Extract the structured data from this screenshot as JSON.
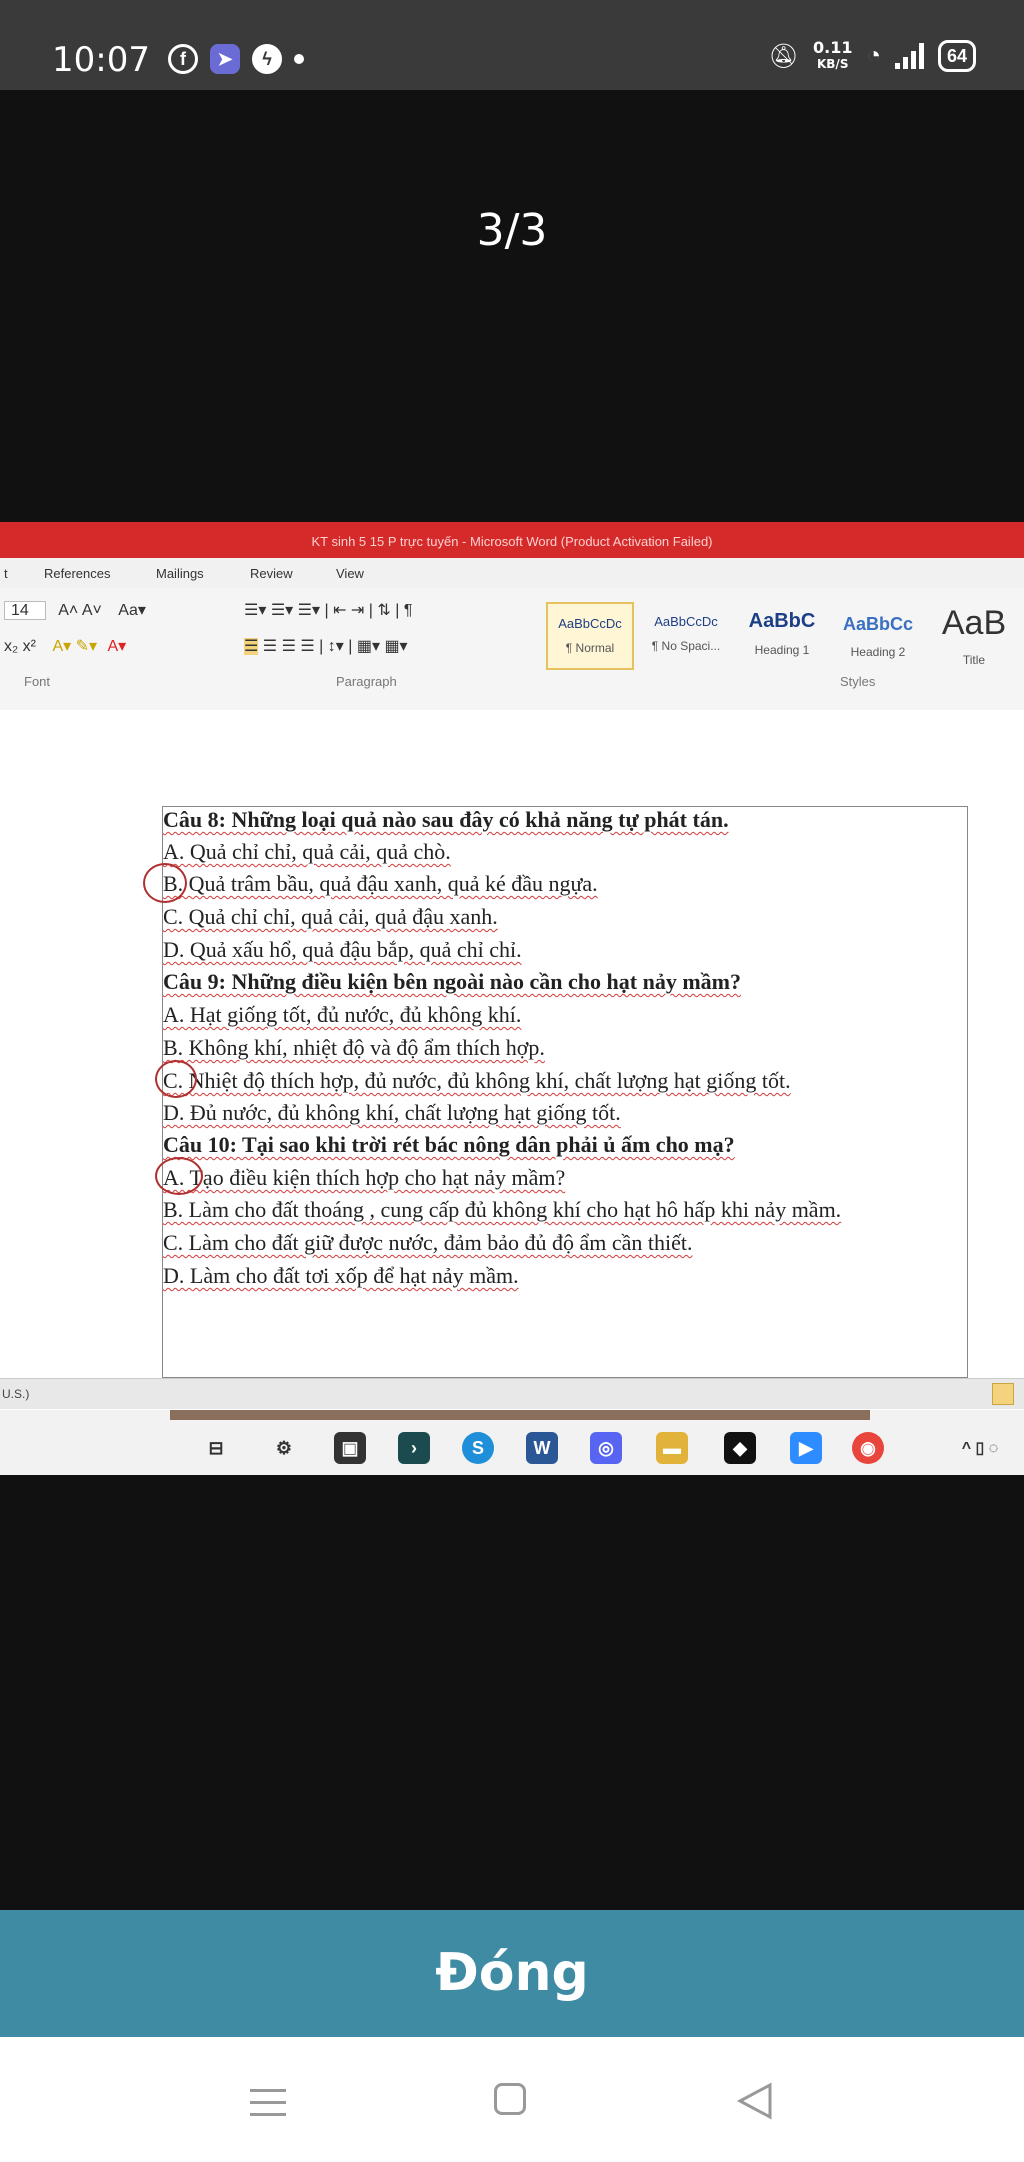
{
  "status_bar": {
    "time": "10:07",
    "speed_value": "0.11",
    "speed_unit": "KB/S",
    "battery": "64",
    "icons": [
      "facebook-icon",
      "app-icon",
      "messenger-icon",
      "mute-icon",
      "wifi-icon",
      "signal-icon",
      "battery-icon"
    ]
  },
  "viewer": {
    "counter": "3/3",
    "close_label": "Đóng"
  },
  "word": {
    "title": "KT sinh 5 15 P trực tuyến - Microsoft Word (Product Activation Failed)",
    "tabs": [
      "t",
      "References",
      "Mailings",
      "Review",
      "View"
    ],
    "font_size": "14",
    "groups": [
      "Font",
      "Paragraph",
      "Styles"
    ],
    "styles": [
      {
        "sample": "AaBbCcDc",
        "name": "¶ Normal"
      },
      {
        "sample": "AaBbCcDc",
        "name": "¶ No Spaci..."
      },
      {
        "sample": "AaBbC",
        "name": "Heading 1"
      },
      {
        "sample": "AaBbCc",
        "name": "Heading 2"
      },
      {
        "sample": "AaB",
        "name": "Title"
      }
    ],
    "status_text": "U.S.)"
  },
  "document": {
    "lines": [
      "Câu 8: Những loại quả nào sau đây có khả năng tự phát tán.",
      "A. Quả chỉ chỉ, quả cải, quả chò.",
      "B.  Quả trâm bầu, quả đậu xanh, quả ké đầu ngựa.",
      "C.  Quả chỉ chỉ, quả cải, quả đậu xanh.",
      "D.  Quả xấu hổ, quả đậu bắp, quả chỉ chỉ.",
      " Câu 9: Những điều kiện bên ngoài nào cần cho hạt nảy mầm?",
      "A. Hạt giống tốt, đủ nước, đủ không khí.",
      "B.  Không khí, nhiệt độ và độ ẩm thích hợp.",
      "C. Nhiệt độ thích hợp, đủ nước, đủ không khí, chất lượng hạt giống tốt.",
      "D. Đủ nước, đủ không khí, chất lượng hạt giống tốt.",
      "Câu 10: Tại sao khi trời rét bác nông dân phải ủ ấm cho mạ?",
      "A. Tạo điều kiện thích hợp cho hạt nảy mầm?",
      "B.  Làm cho đất thoáng , cung cấp đủ không khí cho hạt hô hấp khi nảy mầm.",
      "C. Làm cho đất giữ được nước, đảm bảo đủ độ ẩm cần thiết.",
      "D. Làm cho đất tơi xốp để hạt nảy mầm."
    ]
  }
}
